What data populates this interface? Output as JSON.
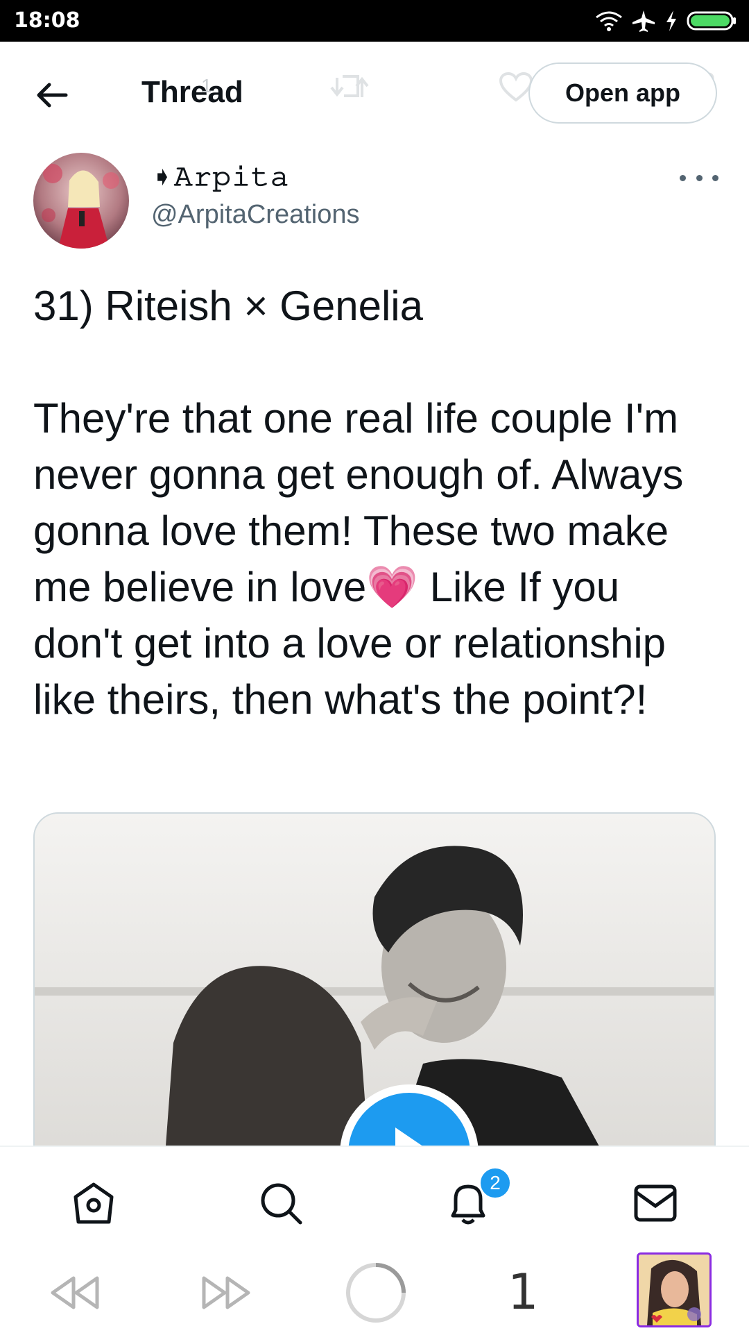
{
  "status_bar": {
    "time": "18:08",
    "icons": [
      "wifi-icon",
      "airplane-icon",
      "charging-icon",
      "battery-icon"
    ]
  },
  "header": {
    "title": "Thread",
    "open_app_label": "Open app",
    "ghost_counts": [
      "1",
      "3"
    ]
  },
  "tweet": {
    "display_name": "➧𝙰𝚛𝚙𝚒𝚝𝚊",
    "handle": "@ArpitaCreations",
    "text": "31) Riteish × Genelia\n\nThey're that one real life couple I'm never gonna get enough of. Always gonna love them! These two make me believe in love💗 Like If you don't get into a love or relationship like theirs, then what's the point?!"
  },
  "bottom_nav": {
    "items": [
      "home-icon",
      "search-icon",
      "notifications-icon",
      "messages-icon"
    ],
    "notification_badge": "2"
  },
  "browser_bar": {
    "tab_count": "1"
  },
  "colors": {
    "accent": "#1d9bf0",
    "text": "#0f1419",
    "secondary": "#536471",
    "border": "#cfd9de"
  }
}
